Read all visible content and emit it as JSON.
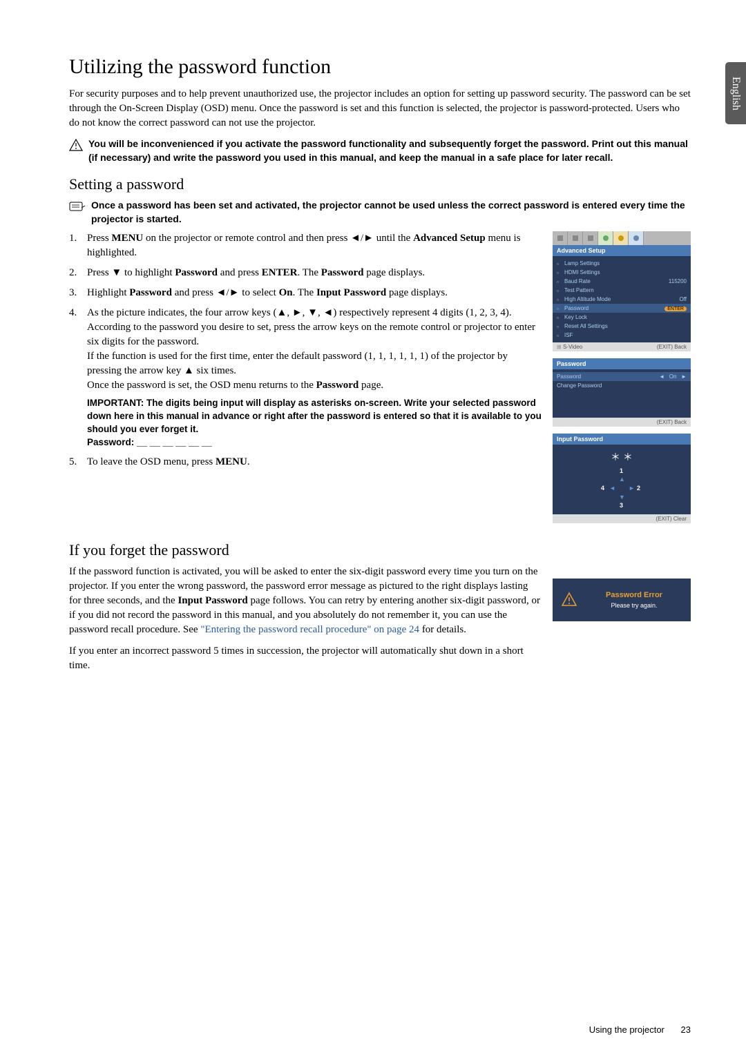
{
  "sideTab": "English",
  "h1": "Utilizing the password function",
  "intro": "For security purposes and to help prevent unauthorized use, the projector includes an option for setting up password security. The password can be set through the On-Screen Display (OSD) menu. Once the password is set and this function is selected, the projector is password-protected. Users who do not know the correct password can not use the projector.",
  "warning": "You will be inconvenienced if you activate the password functionality and subsequently forget the password. Print out this manual (if necessary) and write the password you used in this manual, and keep the manual in a safe place for later recall.",
  "h2a": "Setting a password",
  "note": "Once a password has been set and activated, the projector cannot be used unless the correct password is entered every time the projector is started.",
  "steps": {
    "s1a": "Press ",
    "s1b": "MENU",
    "s1c": " on the projector or remote control and then press ◄/► until the ",
    "s1d": "Advanced Setup",
    "s1e": " menu is highlighted.",
    "s2a": "Press ▼ to highlight ",
    "s2b": "Password",
    "s2c": " and press ",
    "s2d": "ENTER",
    "s2e": ". The ",
    "s2f": "Password",
    "s2g": " page displays.",
    "s3a": "Highlight ",
    "s3b": "Password",
    "s3c": " and press ◄/► to select ",
    "s3d": "On",
    "s3e": ". The ",
    "s3f": "Input Password",
    "s3g": " page displays.",
    "s4a": "As the picture indicates, the four arrow keys (▲, ►, ▼, ◄) respectively represent 4 digits (1, 2, 3, 4). According to the password you desire to set, press the arrow keys on the remote control or projector to enter six digits for the password.",
    "s4b": "If the function is used for the first time, enter the default password (1, 1, 1, 1, 1, 1) of the projector by pressing the arrow key ▲ six times.",
    "s4c": "Once the password is set, the OSD menu returns to the ",
    "s4d": "Password",
    "s4e": " page.",
    "s4imp": "IMPORTANT: The digits being input will display as asterisks on-screen. Write your selected password down here in this manual in advance or right after the password is entered so that it is available to you should you ever forget it.",
    "s4pw": "Password: __ __ __ __ __ __",
    "s5a": "To leave the OSD menu, press ",
    "s5b": "MENU",
    "s5c": "."
  },
  "h2b": "If you forget the password",
  "p2a": "If the password function is activated, you will be asked to enter the six-digit password every time you turn on the projector. If you enter the wrong password, the password error message as pictured to the right displays lasting for three seconds, and the ",
  "p2b": "Input Password",
  "p2c": " page follows. You can retry by entering another six-digit password, or if you did not record the password in this manual, and you absolutely do not remember it, you can use the password recall procedure. See ",
  "p2link": "\"Entering the password recall procedure\" on page 24",
  "p2d": " for details.",
  "p3": "If you enter an incorrect password 5 times in succession, the projector will automatically shut down in a short time.",
  "osd1": {
    "header": "Advanced Setup",
    "items": [
      {
        "label": "Lamp Settings",
        "val": ""
      },
      {
        "label": "HDMI Settings",
        "val": ""
      },
      {
        "label": "Baud Rate",
        "val": "115200"
      },
      {
        "label": "Test Pattern",
        "val": ""
      },
      {
        "label": "High Altitude Mode",
        "val": "Off"
      },
      {
        "label": "Password",
        "val": "ENTER",
        "hl": true
      },
      {
        "label": "Key Lock",
        "val": ""
      },
      {
        "label": "Reset All Settings",
        "val": ""
      },
      {
        "label": "ISF",
        "val": ""
      }
    ],
    "footerLeft": "S-Video",
    "footerRight": "(EXIT) Back"
  },
  "osd2": {
    "header": "Password",
    "items": [
      {
        "label": "Password",
        "val": "On",
        "hl": true,
        "arrows": true
      },
      {
        "label": "Change Password",
        "val": ""
      }
    ],
    "footerRight": "(EXIT) Back"
  },
  "osd3": {
    "header": "Input Password",
    "stars": "＊ ＊",
    "nums": {
      "n1": "1",
      "n2": "2",
      "n3": "3",
      "n4": "4"
    },
    "footerRight": "(EXIT) Clear"
  },
  "error": {
    "title": "Password Error",
    "msg": "Please try again."
  },
  "footer": "Using the projector",
  "pageNum": "23"
}
